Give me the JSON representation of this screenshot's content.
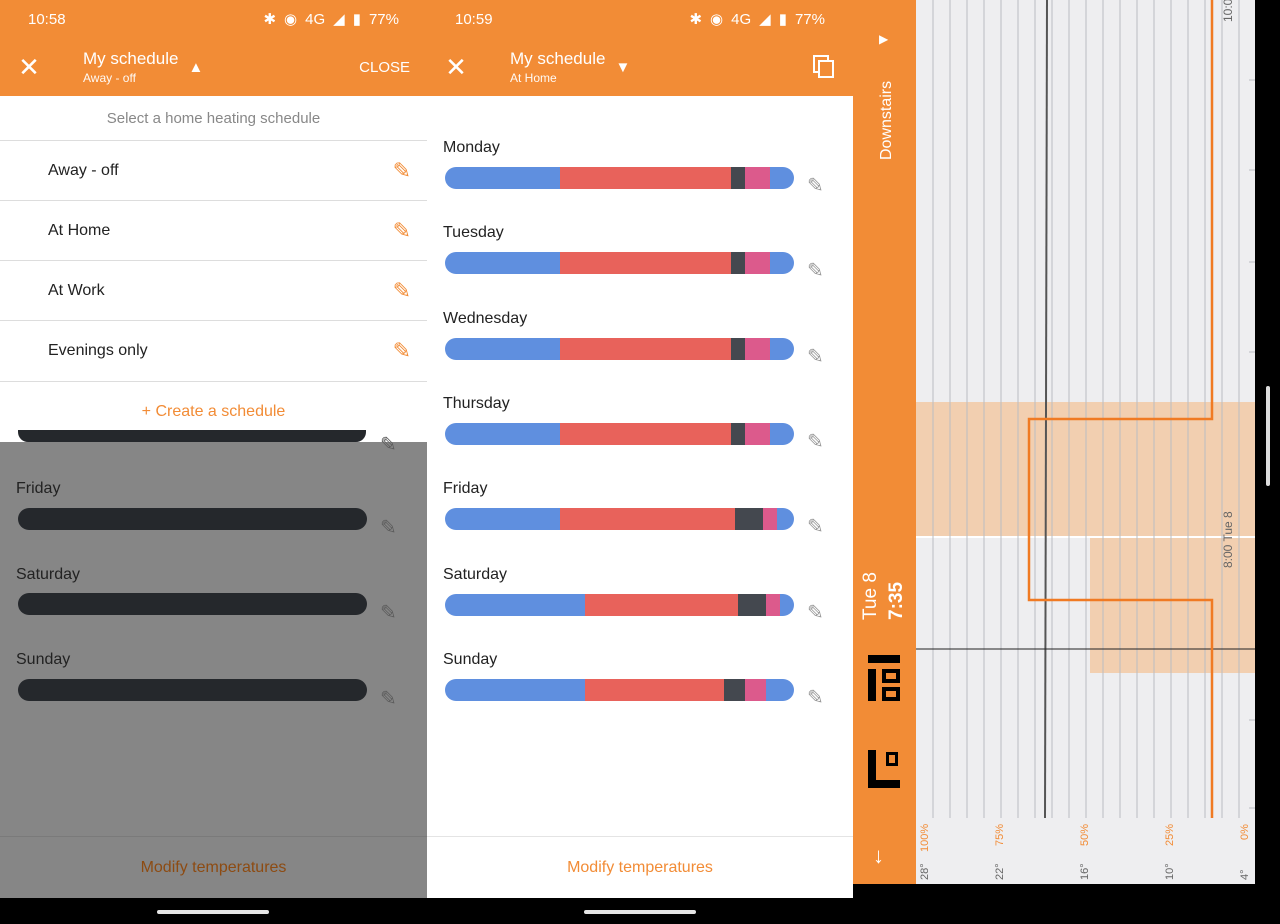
{
  "left": {
    "status": {
      "time": "10:58",
      "network": "4G",
      "battery": "77%"
    },
    "header": {
      "title": "My schedule",
      "subtitle": "Away - off",
      "close_label": "CLOSE"
    },
    "dropdown": {
      "heading": "Select a home heating schedule",
      "items": [
        {
          "label": "Away - off"
        },
        {
          "label": "At Home"
        },
        {
          "label": "At Work"
        },
        {
          "label": "Evenings only"
        }
      ],
      "create_label": "+ Create a schedule"
    },
    "days": [
      {
        "label": "Friday"
      },
      {
        "label": "Saturday"
      },
      {
        "label": "Sunday"
      }
    ],
    "modify_label": "Modify temperatures"
  },
  "middle": {
    "status": {
      "time": "10:59",
      "network": "4G",
      "battery": "77%"
    },
    "header": {
      "title": "My schedule",
      "subtitle": "At Home"
    },
    "days": [
      {
        "label": "Monday"
      },
      {
        "label": "Tuesday"
      },
      {
        "label": "Wednesday"
      },
      {
        "label": "Thursday"
      },
      {
        "label": "Friday"
      },
      {
        "label": "Saturday"
      },
      {
        "label": "Sunday"
      }
    ],
    "modify_label": "Modify temperatures"
  },
  "right": {
    "zone": "Downstairs",
    "date": "Tue 8",
    "time": "7:35",
    "marker_label": "8:00 Tue 8",
    "top_label": "10:0",
    "percent_ticks": [
      "100%",
      "75%",
      "50%",
      "25%",
      "0%"
    ],
    "temp_ticks": [
      "28°",
      "22°",
      "16°",
      "10°",
      "4°"
    ]
  },
  "colors": {
    "accent": "#f28c36",
    "blue": "#5f8fdf",
    "red": "#e8625b",
    "dark": "#44484f",
    "pink": "#dc5a8c"
  }
}
